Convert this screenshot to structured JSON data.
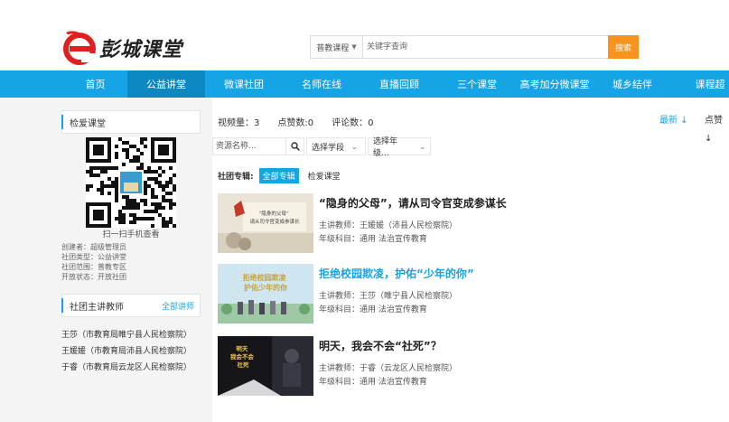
{
  "logo": {
    "text": "彭城课堂",
    "mark": "e"
  },
  "search": {
    "type_label": "普教课程",
    "placeholder": "关键字查询",
    "button": "搜索"
  },
  "nav": [
    {
      "label": "首页"
    },
    {
      "label": "公益讲堂",
      "active": true
    },
    {
      "label": "微课社团"
    },
    {
      "label": "名师在线"
    },
    {
      "label": "直播回顾"
    },
    {
      "label": "三个课堂"
    },
    {
      "label": "高考加分微课堂"
    },
    {
      "label": "城乡结伴"
    },
    {
      "label": "课程超"
    }
  ],
  "sidebar": {
    "club_title": "检爱课堂",
    "qr_caption": "扫一扫手机查看",
    "meta": [
      "创建者：超级管理员",
      "社团类型：公益讲堂",
      "社团范围：普教专区",
      "开放状态：开放社团"
    ],
    "teachers_title": "社团主讲教师",
    "teachers_more": "全部讲师",
    "teachers": [
      "王莎（市教育局睢宁县人民检察院）",
      "王媛媛（市教育局沛县人民检察院）",
      "于睿（市教育局云龙区人民检察院）"
    ]
  },
  "main": {
    "stats": [
      "视频量：3",
      "点赞数:0",
      "评论数：0"
    ],
    "sort_latest": "最新 ↓",
    "sort_clicks": "点赞 ↓",
    "filter": {
      "resource_placeholder": "资源名称...",
      "stage_label": "选择学段",
      "grade_label": "选择年级..."
    },
    "chips_label": "社团专辑:",
    "chips": [
      "全部专辑",
      "检爱课堂"
    ],
    "courses": [
      {
        "title": "“隐身的父母”，请从司令官变成参谋长",
        "teacher": "主讲教师：王媛媛（沛县人民检察院）",
        "subject": "年级科目：通用 法治宣传教育",
        "thumb_text": "“隐身的父母” 请从司令官变成参谋长"
      },
      {
        "title": "拒绝校园欺凌，护佑“少年的你”",
        "teacher": "主讲教师：王莎（睢宁县人民检察院）",
        "subject": "年级科目：通用 法治宣传教育",
        "thumb_text": "拒绝校园欺凌 护佑少年的你"
      },
      {
        "title": "明天，我会不会“社死”？",
        "teacher": "主讲教师：于睿（云龙区人民检察院）",
        "subject": "年级科目：通用 法治宣传教育",
        "thumb_text": "明天 我会不会 社死"
      }
    ]
  },
  "colors": {
    "brand_blue": "#15a4e6",
    "nav_active": "#0c87c2",
    "search_btn": "#f7941d",
    "logo_red": "#e02020"
  }
}
